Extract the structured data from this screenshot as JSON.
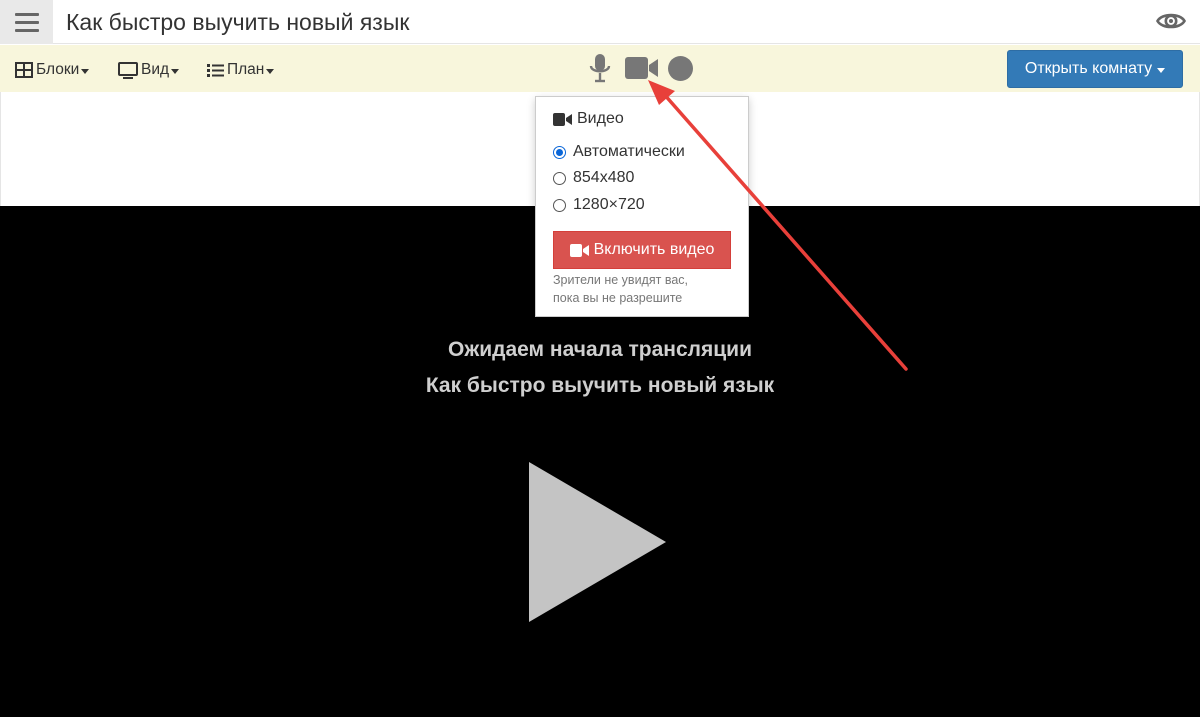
{
  "header": {
    "title": "Как быстро выучить новый язык",
    "menu_icon": "hamburger-icon",
    "visibility_icon": "eye-icon"
  },
  "toolbar": {
    "blocks_label": "Блоки",
    "view_label": "Вид",
    "plan_label": "План",
    "media_icons": [
      "microphone-icon",
      "video-camera-icon",
      "record-icon"
    ],
    "open_room_label": "Открыть комнату",
    "open_room_color": "#337ab7",
    "background": "#f8f6dc"
  },
  "video_popover": {
    "heading": "Видео",
    "options": [
      {
        "label": "Автоматически",
        "selected": true
      },
      {
        "label": "854x480",
        "selected": false
      },
      {
        "label": "1280×720",
        "selected": false
      }
    ],
    "enable_button_label": "Включить видео",
    "enable_button_color": "#d9534f",
    "note_line1": "Зрители не увидят вас,",
    "note_line2": "пока вы не разрешите"
  },
  "player": {
    "status_text": "Ожидаем начала трансляции",
    "stream_title": "Как быстро выучить новый язык",
    "play_icon": "play-icon",
    "background": "#000000"
  },
  "annotation": {
    "arrow_color": "#e8403a",
    "arrow_target": "video-camera-icon"
  }
}
